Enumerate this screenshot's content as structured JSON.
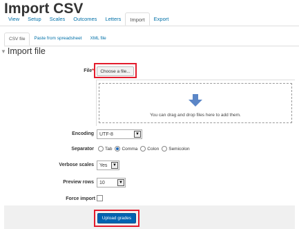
{
  "page": {
    "title": "Import CSV"
  },
  "tabs": [
    {
      "label": "View"
    },
    {
      "label": "Setup"
    },
    {
      "label": "Scales"
    },
    {
      "label": "Outcomes"
    },
    {
      "label": "Letters"
    },
    {
      "label": "Import",
      "active": true
    },
    {
      "label": "Export"
    }
  ],
  "subtabs": [
    {
      "label": "CSV file",
      "active": true
    },
    {
      "label": "Paste from spreadsheet"
    },
    {
      "label": "XML file"
    }
  ],
  "section": {
    "title": "Import file"
  },
  "form": {
    "file": {
      "label": "File",
      "required_mark": "*",
      "button": "Choose a file...",
      "drop_hint": "You can drag and drop files here to add them."
    },
    "encoding": {
      "label": "Encoding",
      "value": "UTF-8"
    },
    "separator": {
      "label": "Separator",
      "options": [
        "Tab",
        "Comma",
        "Colon",
        "Semicolon"
      ],
      "selected": "Comma"
    },
    "verbose_scales": {
      "label": "Verbose scales",
      "value": "Yes"
    },
    "preview_rows": {
      "label": "Preview rows",
      "value": "10"
    },
    "force_import": {
      "label": "Force import",
      "checked": false
    }
  },
  "actions": {
    "upload": "Upload grades"
  },
  "colors": {
    "link": "#0070a8",
    "primary": "#0063b1",
    "highlight": "#e31b2c",
    "required": "#cc0000"
  }
}
